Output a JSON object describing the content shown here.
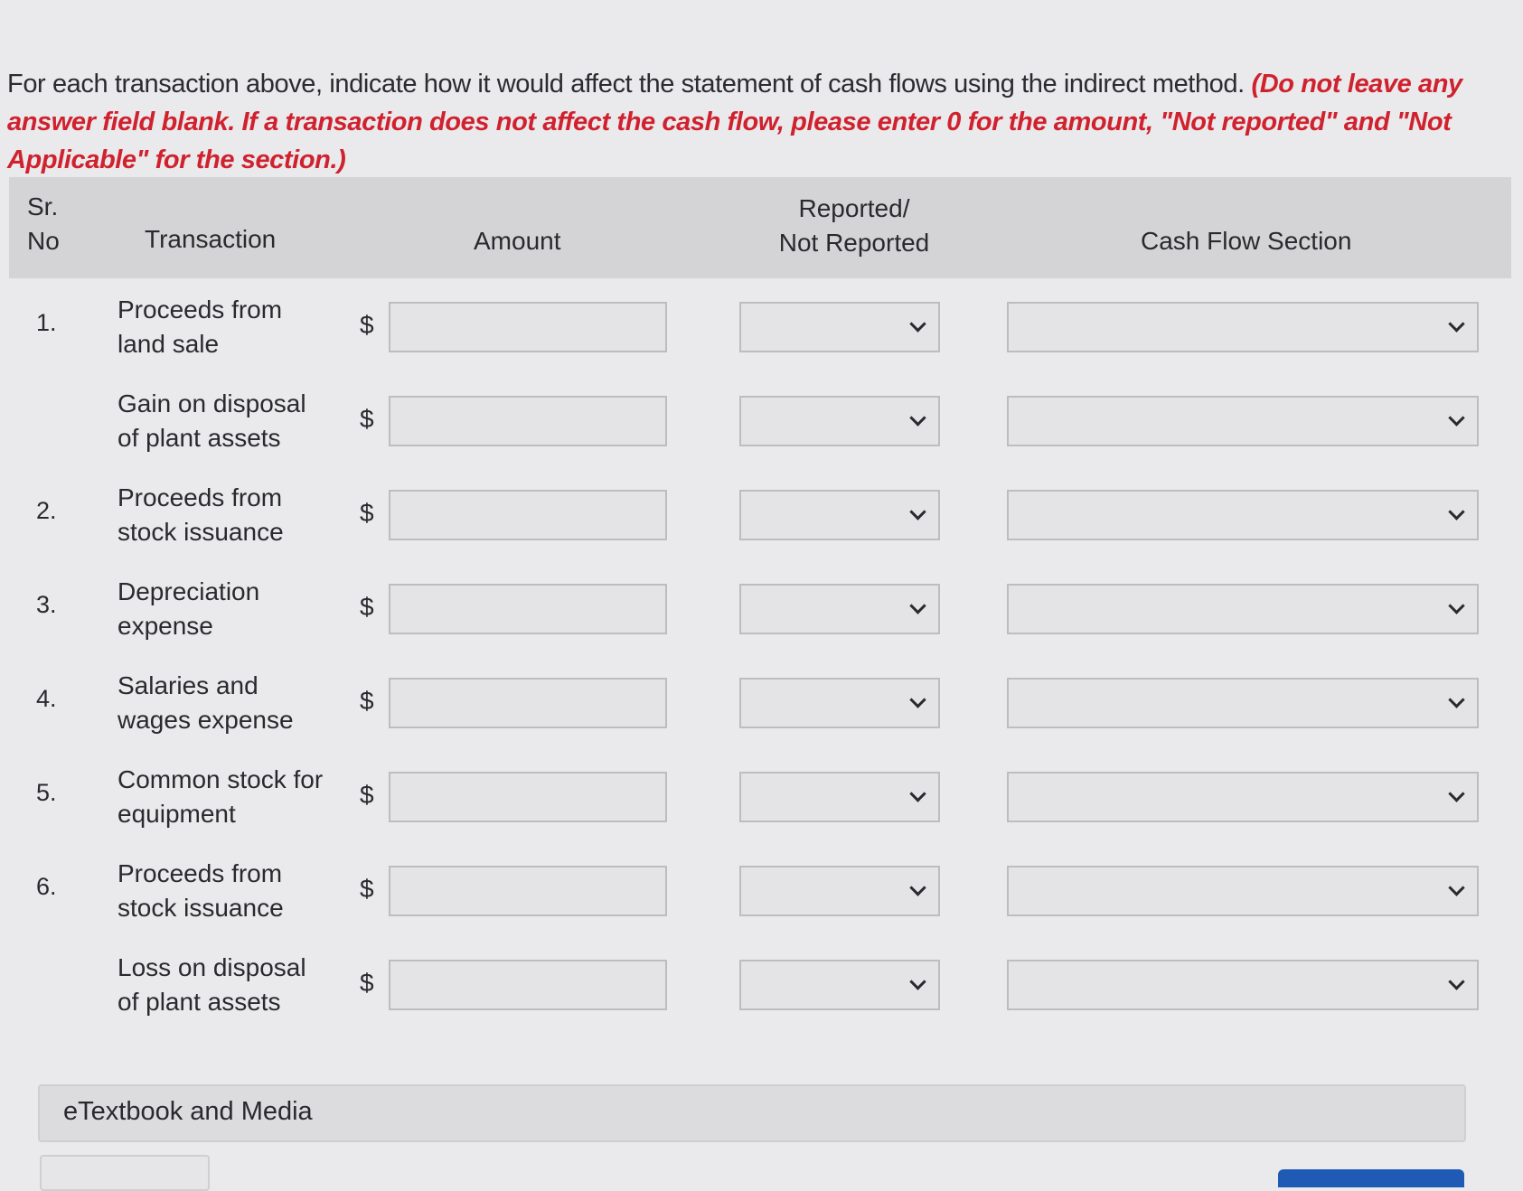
{
  "instructions": {
    "text": "For each transaction above, indicate how it would affect the statement of cash flows using the indirect method. ",
    "warning": "(Do not leave any answer field blank. If a transaction does not affect the cash flow, please enter 0 for the amount, \"Not reported\" and \"Not Applicable\" for the section.)"
  },
  "table": {
    "headers": {
      "sr_no_line1": "Sr.",
      "sr_no_line2": "No",
      "transaction": "Transaction",
      "amount": "Amount",
      "reported_line1": "Reported/",
      "reported_line2": "Not Reported",
      "cash_flow_section": "Cash Flow Section"
    },
    "currency_symbol": "$",
    "rows": [
      {
        "sr": "1.",
        "transaction": "Proceeds from land sale",
        "amount": "",
        "reported": "",
        "section": ""
      },
      {
        "sr": "",
        "transaction": "Gain on disposal of plant assets",
        "amount": "",
        "reported": "",
        "section": ""
      },
      {
        "sr": "2.",
        "transaction": "Proceeds from stock issuance",
        "amount": "",
        "reported": "",
        "section": ""
      },
      {
        "sr": "3.",
        "transaction": "Depreciation expense",
        "amount": "",
        "reported": "",
        "section": ""
      },
      {
        "sr": "4.",
        "transaction": "Salaries and wages expense",
        "amount": "",
        "reported": "",
        "section": ""
      },
      {
        "sr": "5.",
        "transaction": "Common stock for equipment",
        "amount": "",
        "reported": "",
        "section": ""
      },
      {
        "sr": "6.",
        "transaction": "Proceeds from stock issuance",
        "amount": "",
        "reported": "",
        "section": ""
      },
      {
        "sr": "",
        "transaction": "Loss on disposal of plant assets",
        "amount": "",
        "reported": "",
        "section": ""
      }
    ]
  },
  "etextbook": {
    "label": "eTextbook and Media"
  },
  "icons": {
    "dropdown": "chevron-down-icon"
  },
  "colors": {
    "warning": "#d0212e",
    "header_bg": "#d4d4d6",
    "submit": "#1f5bb5"
  }
}
